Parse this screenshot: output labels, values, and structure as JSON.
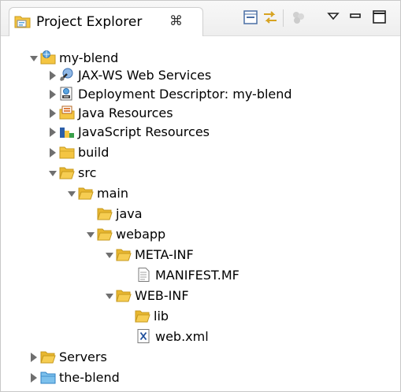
{
  "view": {
    "title": "Project Explorer",
    "close_glyph": "⌘",
    "toolbar_icons": [
      "collapse-all-icon",
      "link-with-editor-icon",
      "focus-on-active-task-icon",
      "view-menu-icon",
      "minimize-icon",
      "maximize-icon"
    ]
  },
  "tree": [
    {
      "label": "my-blend",
      "expanded": true,
      "icon": "web-project-icon"
    },
    {
      "label": "JAX-WS Web Services",
      "expanded": false,
      "icon": "jax-ws-icon"
    },
    {
      "label": "Deployment Descriptor: my-blend",
      "expanded": false,
      "icon": "deployment-descriptor-icon"
    },
    {
      "label": "Java Resources",
      "expanded": false,
      "icon": "java-resources-icon"
    },
    {
      "label": "JavaScript Resources",
      "expanded": false,
      "icon": "javascript-resources-icon"
    },
    {
      "label": "build",
      "expanded": false,
      "icon": "folder-icon"
    },
    {
      "label": "src",
      "expanded": true,
      "icon": "folder-icon"
    },
    {
      "label": "main",
      "expanded": true,
      "icon": "folder-icon"
    },
    {
      "label": "java",
      "expanded": null,
      "icon": "folder-icon"
    },
    {
      "label": "webapp",
      "expanded": true,
      "icon": "folder-icon"
    },
    {
      "label": "META-INF",
      "expanded": true,
      "icon": "folder-icon"
    },
    {
      "label": "MANIFEST.MF",
      "expanded": null,
      "icon": "text-file-icon"
    },
    {
      "label": "WEB-INF",
      "expanded": true,
      "icon": "folder-icon"
    },
    {
      "label": "lib",
      "expanded": null,
      "icon": "folder-icon"
    },
    {
      "label": "web.xml",
      "expanded": null,
      "icon": "xml-file-icon"
    },
    {
      "label": "Servers",
      "expanded": false,
      "icon": "folder-icon"
    },
    {
      "label": "the-blend",
      "expanded": false,
      "icon": "project-folder-icon"
    }
  ],
  "colors": {
    "folder": "#f4c542",
    "folder_stroke": "#c79a1e",
    "twisty": "#6f6f6f",
    "project_blue": "#5aa5e0"
  }
}
